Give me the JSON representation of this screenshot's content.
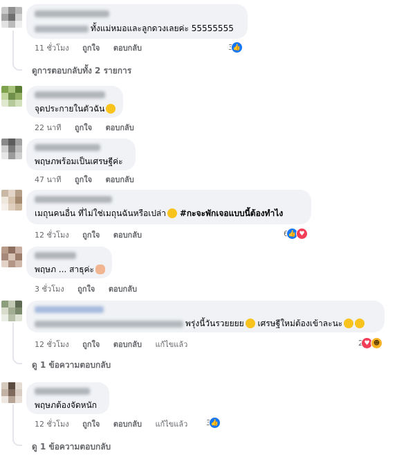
{
  "comments": [
    {
      "text": "ทั้งแม่หมอและลูกดวงเลยค่ะ 55555555",
      "time": "11 ชั่วโมง",
      "like": "ถูกใจ",
      "reply": "ตอบกลับ",
      "edited": "",
      "reaction_count": "3",
      "reactions": [
        "like-icon"
      ]
    },
    {
      "text": "จุดประกายในตัวฉัน",
      "emoji": [
        "laughing-emoji"
      ],
      "time": "22 นาที",
      "like": "ถูกใจ",
      "reply": "ตอบกลับ",
      "edited": "",
      "reaction_count": "",
      "reactions": []
    },
    {
      "text": "พฤษภพร้อมเป็นเศรษฐีค่ะ",
      "time": "47 นาที",
      "like": "ถูกใจ",
      "reply": "ตอบกลับ",
      "edited": "",
      "reaction_count": "",
      "reactions": []
    },
    {
      "text": "เมถุนคนอื่น ที่ไม่ใช่เมถุนฉันหรือเปล่า",
      "emoji": [
        "laughing-emoji"
      ],
      "hashtag": "#กะจะพักเจอแบบนี้ต้องทำไง",
      "time": "12 ชั่วโมง",
      "like": "ถูกใจ",
      "reply": "ตอบกลับ",
      "edited": "",
      "reaction_count": "6",
      "reactions": [
        "like-icon",
        "love-icon"
      ]
    },
    {
      "text": "พฤษภ ... สาธุค่ะ",
      "emoji": [
        "praying-hands-emoji"
      ],
      "time": "3 ชั่วโมง",
      "like": "ถูกใจ",
      "reply": "ตอบกลับ",
      "edited": "",
      "reaction_count": "",
      "reactions": []
    },
    {
      "text": "พรุ่งนี้วันรวยยยย",
      "text2": "เศรษฐีใหม่ต้องเข้าละนะ",
      "emoji": [
        "smiling-heart-emoji"
      ],
      "emoji2": [
        "smiling-heart-emoji",
        "grimacing-emoji"
      ],
      "time": "12 ชั่วโมง",
      "like": "ถูกใจ",
      "reply": "ตอบกลับ",
      "edited": "แก้ไขแล้ว",
      "reaction_count": "2",
      "reactions": [
        "love-icon",
        "haha-icon"
      ]
    },
    {
      "text": "พฤษภต้องจัดหนัก",
      "time": "12 ชั่วโมง",
      "like": "ถูกใจ",
      "reply": "ตอบกลับ",
      "edited": "แก้ไขแล้ว",
      "reaction_count": "3",
      "reactions": [
        "like-icon"
      ]
    }
  ],
  "view_replies": [
    "ดูการตอบกลับทั้ง 2 รายการ",
    "ดู 1 ข้อความตอบกลับ",
    "ดู 1 ข้อความตอบกลับ"
  ],
  "colors": {
    "bubble": "#f0f2f5",
    "meta": "#65676b",
    "like": "#1877f2",
    "love": "#f33e58",
    "haha": "#f7b125"
  }
}
